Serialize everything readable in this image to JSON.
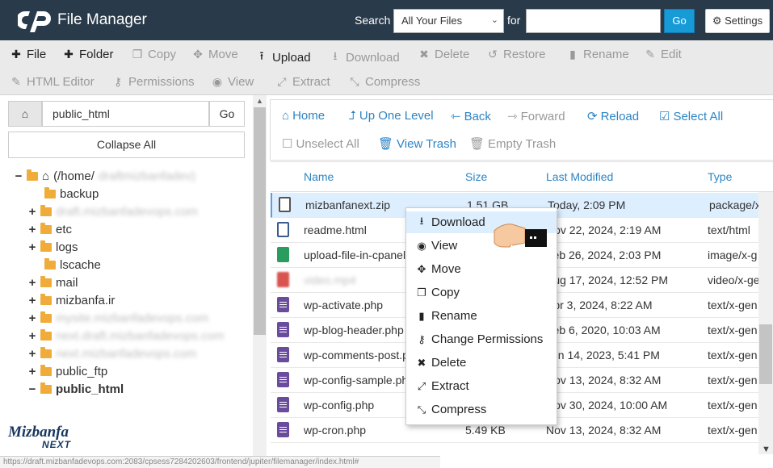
{
  "header": {
    "app_title": "File Manager",
    "search_label": "Search",
    "search_scope": "All Your Files",
    "for_label": "for",
    "search_value": "",
    "go_label": "Go",
    "settings_label": "Settings"
  },
  "toolbar": {
    "file": "File",
    "folder": "Folder",
    "copy": "Copy",
    "move": "Move",
    "upload": "Upload",
    "download": "Download",
    "delete": "Delete",
    "restore": "Restore",
    "rename": "Rename",
    "edit": "Edit",
    "html_editor": "HTML Editor",
    "permissions": "Permissions",
    "view": "View",
    "extract": "Extract",
    "compress": "Compress"
  },
  "left_panel": {
    "path_value": "public_html",
    "go_label": "Go",
    "collapse_all": "Collapse All",
    "tree": [
      {
        "label": "(/home/",
        "blurred_suffix": "draftmizbanfadev)",
        "toggle": "−"
      },
      {
        "label": "backup",
        "toggle": ""
      },
      {
        "label": "draft.mizbanfadevops.com",
        "toggle": "+",
        "blurred": true
      },
      {
        "label": "etc",
        "toggle": "+"
      },
      {
        "label": "logs",
        "toggle": "+"
      },
      {
        "label": "lscache",
        "toggle": ""
      },
      {
        "label": "mail",
        "toggle": "+"
      },
      {
        "label": "mizbanfa.ir",
        "toggle": "+"
      },
      {
        "label": "mysite.mizbanfadevops.com",
        "toggle": "+",
        "blurred": true
      },
      {
        "label": "next.draft.mizbanfadevops.com",
        "toggle": "+",
        "blurred": true
      },
      {
        "label": "next.mizbanfadevops.com",
        "toggle": "+",
        "blurred": true
      },
      {
        "label": "public_ftp",
        "toggle": "+"
      },
      {
        "label": "public_html",
        "toggle": "−",
        "bold": true
      }
    ],
    "brand_line1": "Mizbanfa",
    "brand_line2": "NEXT"
  },
  "nav": {
    "home": "Home",
    "up_one_level": "Up One Level",
    "back": "Back",
    "forward": "Forward",
    "reload": "Reload",
    "select_all": "Select All",
    "unselect_all": "Unselect All",
    "view_trash": "View Trash",
    "empty_trash": "Empty Trash"
  },
  "columns": {
    "name": "Name",
    "size": "Size",
    "modified": "Last Modified",
    "type": "Type"
  },
  "files": [
    {
      "name": "mizbanfanext.zip",
      "size": "1.51 GB",
      "modified": "Today, 2:09 PM",
      "type": "package/x",
      "icon": "zip"
    },
    {
      "name": "readme.html",
      "size": "",
      "modified": "Nov 22, 2024, 2:19 AM",
      "type": "text/html",
      "icon": "code"
    },
    {
      "name": "upload-file-in-cpanel",
      "size": "",
      "modified": "Feb 26, 2024, 2:03 PM",
      "type": "image/x-g",
      "icon": "img"
    },
    {
      "name": "video.mp4",
      "size": "",
      "modified": "Aug 17, 2024, 12:52 PM",
      "type": "video/x-ge",
      "icon": "vid"
    },
    {
      "name": "wp-activate.php",
      "size": "",
      "modified": "Apr 3, 2024, 8:22 AM",
      "type": "text/x-gen",
      "icon": "doc"
    },
    {
      "name": "wp-blog-header.php",
      "size": "",
      "modified": "Feb 6, 2020, 10:03 AM",
      "type": "text/x-gen",
      "icon": "doc"
    },
    {
      "name": "wp-comments-post.php",
      "size": "",
      "modified": "Jun 14, 2023, 5:41 PM",
      "type": "text/x-gen",
      "icon": "doc"
    },
    {
      "name": "wp-config-sample.php",
      "size": "",
      "modified": "Nov 13, 2024, 8:32 AM",
      "type": "text/x-gen",
      "icon": "doc"
    },
    {
      "name": "wp-config.php",
      "size": "",
      "modified": "Nov 30, 2024, 10:00 AM",
      "type": "text/x-gen",
      "icon": "doc"
    },
    {
      "name": "wp-cron.php",
      "size": "5.49 KB",
      "modified": "Nov 13, 2024, 8:32 AM",
      "type": "text/x-gen",
      "icon": "doc"
    }
  ],
  "context_menu": [
    {
      "label": "Download",
      "icon": "download-icon",
      "active": true
    },
    {
      "label": "View",
      "icon": "eye-icon"
    },
    {
      "label": "Move",
      "icon": "move-icon"
    },
    {
      "label": "Copy",
      "icon": "copy-icon"
    },
    {
      "label": "Rename",
      "icon": "file-icon"
    },
    {
      "label": "Change Permissions",
      "icon": "key-icon"
    },
    {
      "label": "Delete",
      "icon": "x-icon"
    },
    {
      "label": "Extract",
      "icon": "extract-icon"
    },
    {
      "label": "Compress",
      "icon": "compress-icon"
    }
  ],
  "status_bar": "https://draft.mizbanfadevops.com:2083/cpsess7284202603/frontend/jupiter/filemanager/index.html#"
}
